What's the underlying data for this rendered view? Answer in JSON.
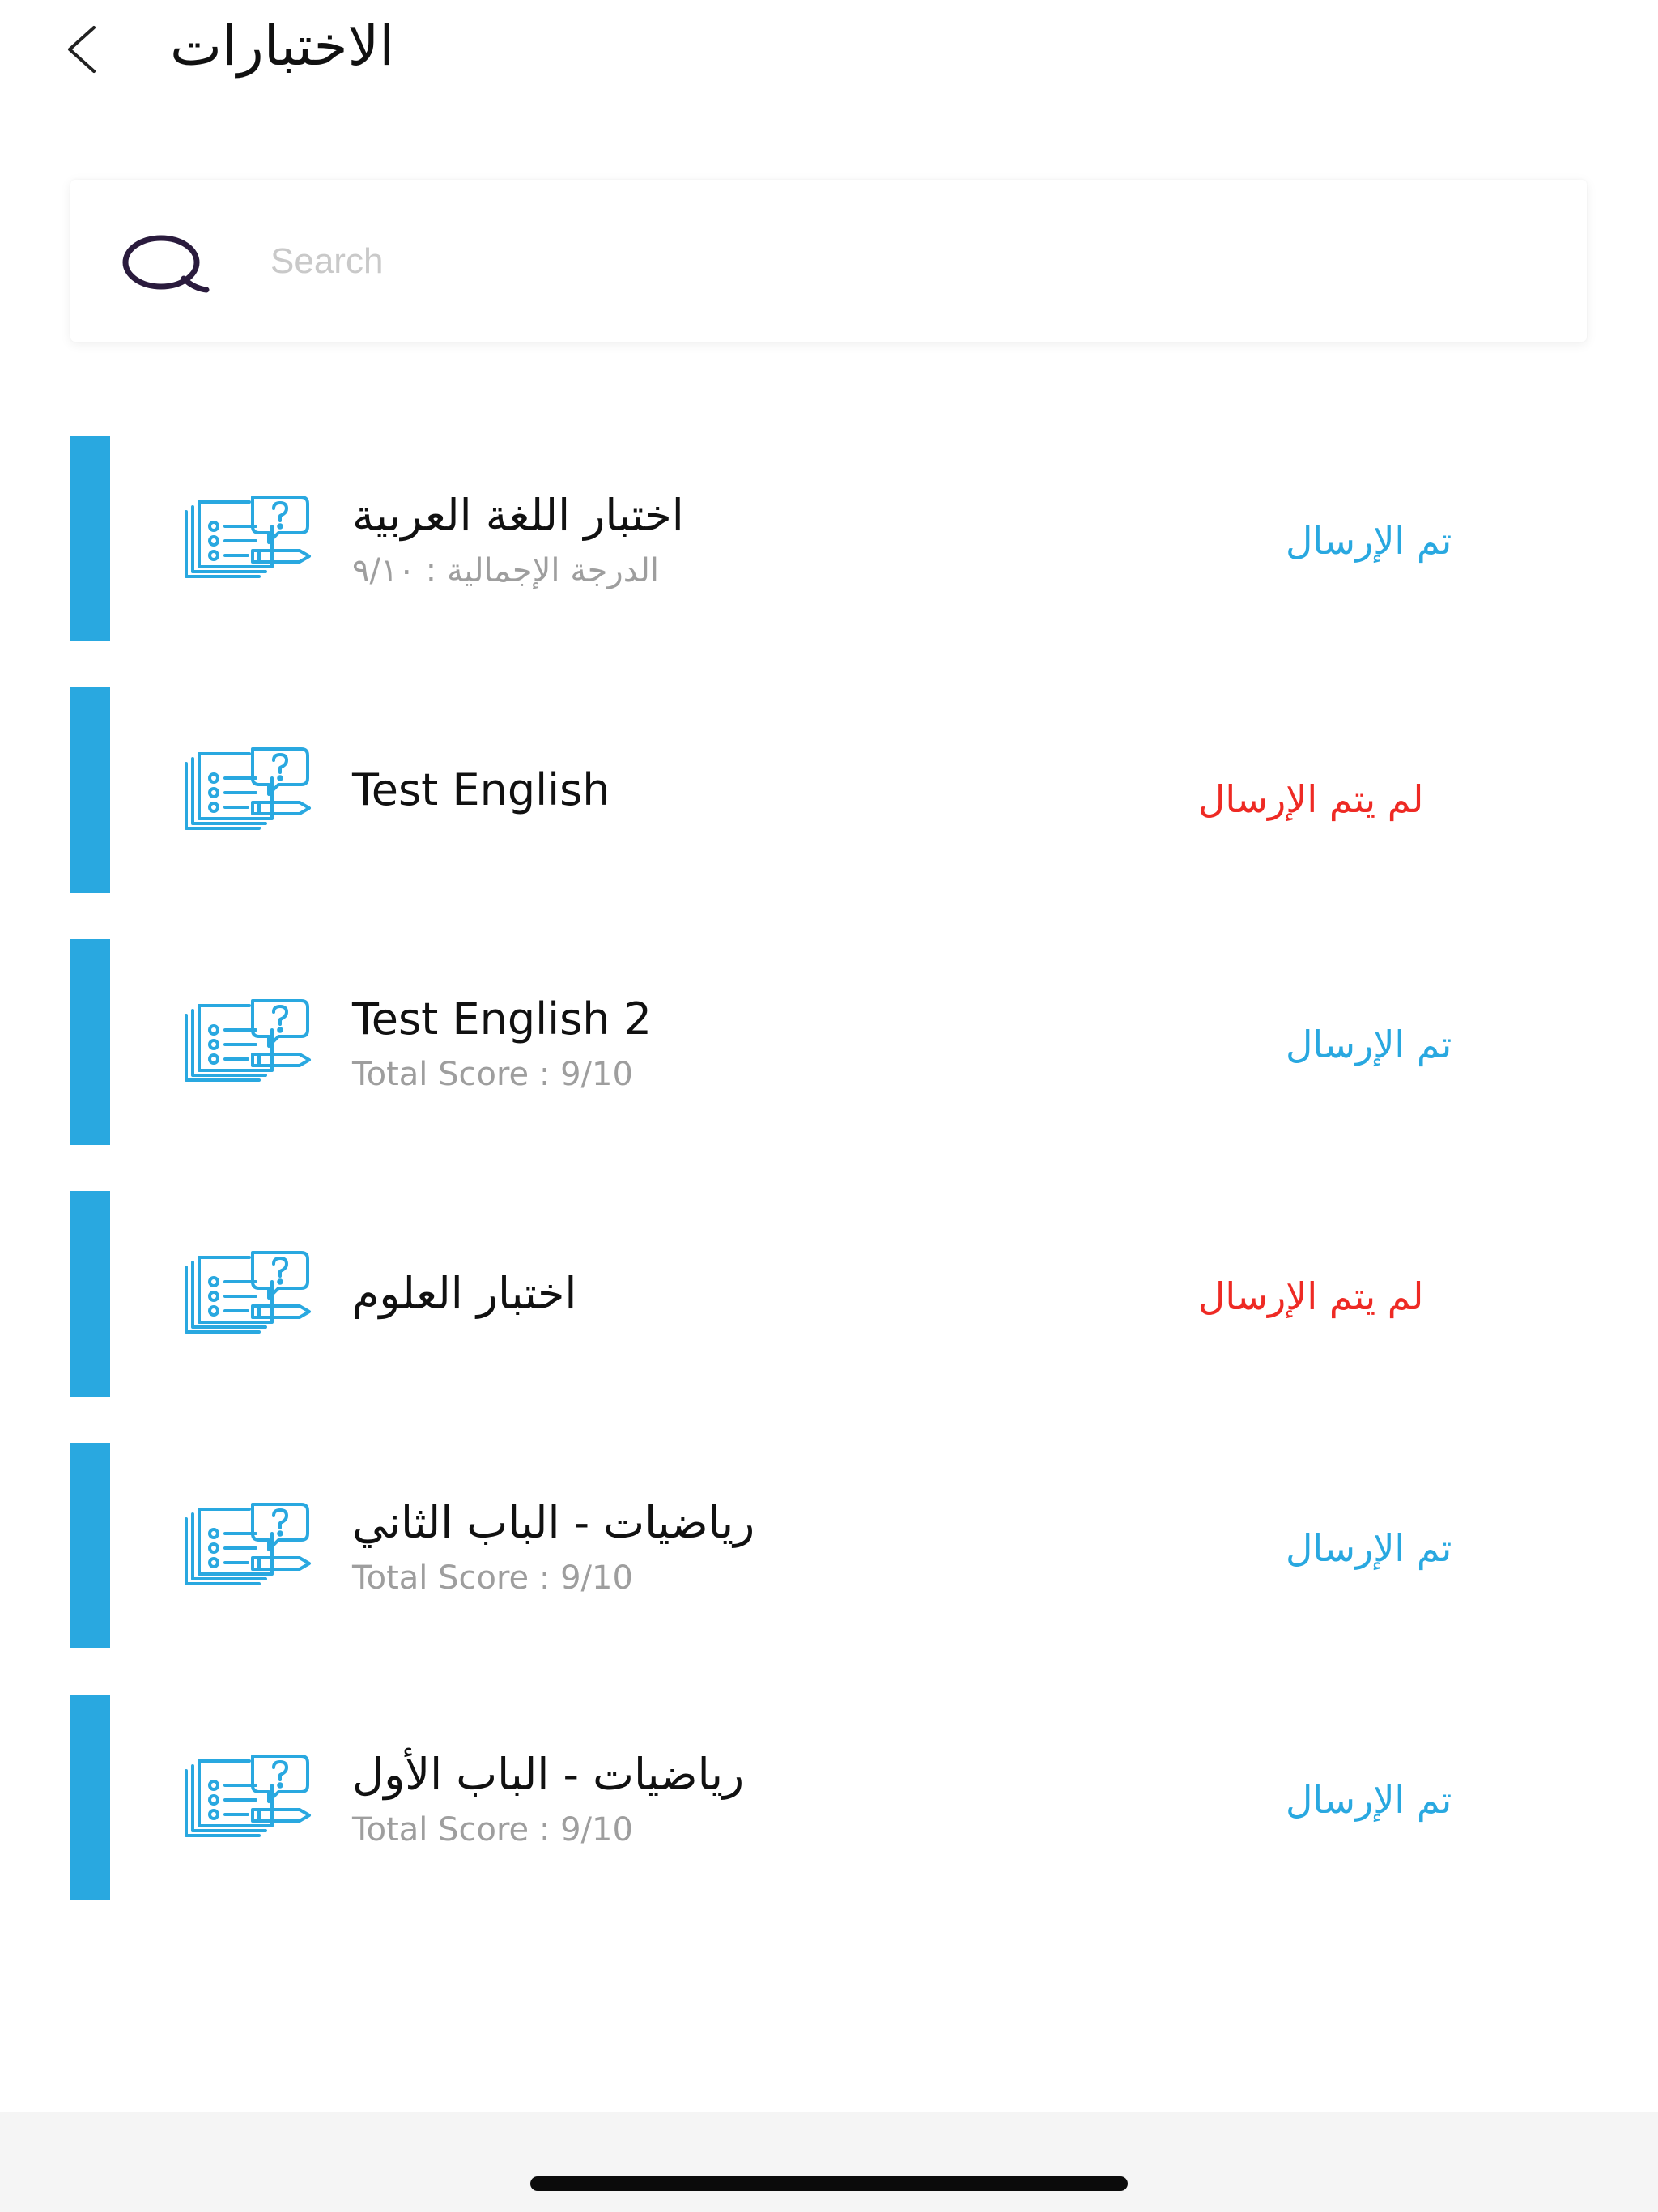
{
  "header": {
    "title": "الاختبارات",
    "back_icon": "chevron-left-icon"
  },
  "search": {
    "placeholder": "Search",
    "icon": "search-icon"
  },
  "colors": {
    "accent": "#29a8e0",
    "submitted": "#29a8e0",
    "not_submitted": "#ee2a24",
    "score": "#9e9e9e",
    "icon": "#29a8e0",
    "search_icon": "#2a1b3d"
  },
  "quizzes": [
    {
      "title": "اختبار اللغة العربية",
      "score": "الدرجة الإجمالية : ٩/١٠",
      "status": "تم الإرسال",
      "submitted": true
    },
    {
      "title": "Test English",
      "score": "",
      "status": "لم يتم الإرسال",
      "submitted": false
    },
    {
      "title": "Test English 2",
      "score": "Total Score : 9/10",
      "status": "تم الإرسال",
      "submitted": true
    },
    {
      "title": "اختبار العلوم",
      "score": "",
      "status": "لم يتم الإرسال",
      "submitted": false
    },
    {
      "title": "رياضيات - الباب الثاني",
      "score": "Total Score : 9/10",
      "status": "تم الإرسال",
      "submitted": true
    },
    {
      "title": "رياضيات - الباب الأول",
      "score": "Total Score : 9/10",
      "status": "تم الإرسال",
      "submitted": true
    }
  ]
}
